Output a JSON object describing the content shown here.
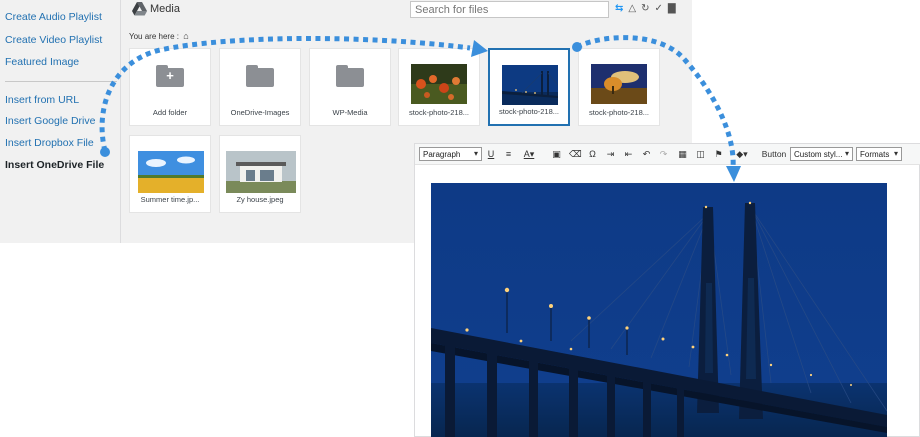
{
  "sidebar": {
    "items": [
      {
        "label": "Create Audio Playlist"
      },
      {
        "label": "Create Video Playlist"
      },
      {
        "label": "Featured Image"
      },
      {
        "label": "Insert from URL"
      },
      {
        "label": "Insert Google Drive"
      },
      {
        "label": "Insert Dropbox File"
      },
      {
        "label": "Insert OneDrive File",
        "active": true
      }
    ]
  },
  "media": {
    "title": "Media",
    "search_placeholder": "Search for files",
    "breadcrumb": "You are here :",
    "toolbar_icons": [
      "sync-icon",
      "shape-icon",
      "refresh-icon",
      "check-all-icon",
      "trash-icon"
    ],
    "tiles": [
      {
        "label": "Add folder",
        "kind": "add-folder"
      },
      {
        "label": "OneDrive-Images",
        "kind": "folder"
      },
      {
        "label": "WP-Media",
        "kind": "folder"
      },
      {
        "label": "stock-photo-218...",
        "kind": "image",
        "subject": "flowers"
      },
      {
        "label": "stock-photo-218...",
        "kind": "image",
        "subject": "bridge-night",
        "selected": true
      },
      {
        "label": "stock-photo-218...",
        "kind": "image",
        "subject": "field-tree"
      },
      {
        "label": "Summer time.jp...",
        "kind": "image",
        "subject": "summer-field"
      },
      {
        "label": "Zy house.jpeg",
        "kind": "image",
        "subject": "house"
      }
    ]
  },
  "editor": {
    "format_select": "Paragraph",
    "button_label": "Button",
    "custom_style_select": "Custom styl...",
    "formats_select": "Formats",
    "toolbar_icons": [
      "underline-icon",
      "align-justify-icon",
      "text-color-icon",
      "paste-text-icon",
      "clear-format-icon",
      "special-char-icon",
      "indent-icon",
      "outdent-icon",
      "undo-icon",
      "redo-icon",
      "table-icon",
      "columns-icon",
      "bookmark-icon",
      "paint-icon"
    ],
    "image_subject": "cable-stayed bridge at night"
  },
  "colors": {
    "accent": "#2271b1",
    "flow_arrow": "#3b8fdc",
    "sidebar_bg": "#f1f1f1"
  }
}
